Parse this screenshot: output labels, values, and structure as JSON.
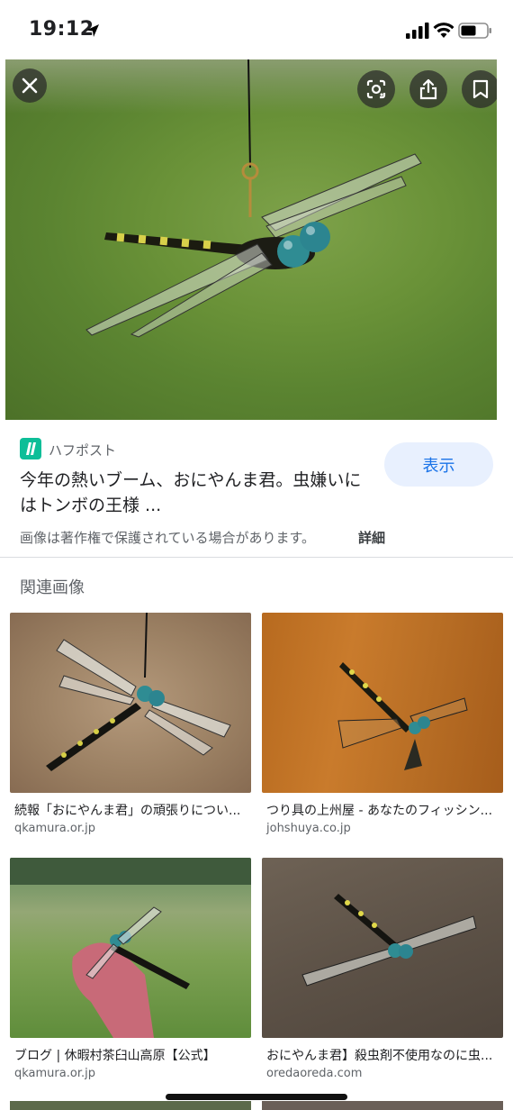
{
  "status_bar": {
    "time": "19:12",
    "icons": [
      "location-arrow-icon",
      "cellular-signal-icon",
      "wifi-icon",
      "battery-icon"
    ]
  },
  "hero": {
    "buttons": [
      "close-icon",
      "lens-icon",
      "share-icon",
      "bookmark-icon"
    ]
  },
  "result": {
    "source": "ハフポスト",
    "title": "今年の熱いブーム、おにやんま君。虫嫌いにはトンボの王様 ...",
    "view_label": "表示",
    "copyright_notice": "画像は著作権で保護されている場合があります。",
    "details_label": "詳細"
  },
  "related": {
    "heading": "関連画像",
    "items": [
      {
        "title": "続報「おにやんま君」の頑張りについ...",
        "domain": "qkamura.or.jp"
      },
      {
        "title": "つり具の上州屋 - あなたのフィッシン...",
        "domain": "johshuya.co.jp"
      },
      {
        "title": "ブログ | 休暇村茶臼山高原【公式】",
        "domain": "qkamura.or.jp"
      },
      {
        "title": "おにやんま君】殺虫剤不使用なのに虫...",
        "domain": "oredaoreda.com"
      }
    ]
  },
  "colors": {
    "accent": "#1a73e8",
    "view_button_bg": "#e8f0fe",
    "source_logo": "#0dbe98"
  }
}
